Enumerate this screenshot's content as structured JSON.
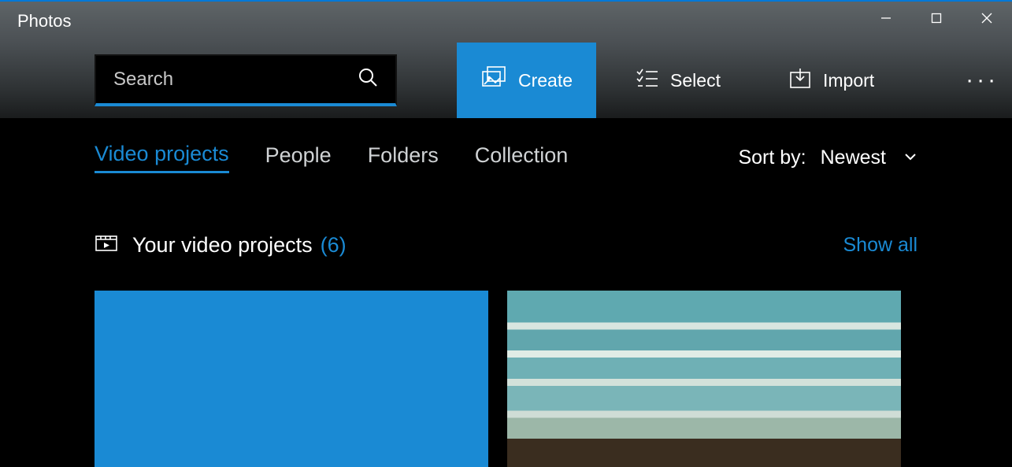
{
  "app": {
    "title": "Photos"
  },
  "search": {
    "placeholder": "Search"
  },
  "toolbar": {
    "create_label": "Create",
    "select_label": "Select",
    "import_label": "Import"
  },
  "tabs": {
    "video_projects": "Video projects",
    "people": "People",
    "folders": "Folders",
    "collection": "Collection"
  },
  "sort": {
    "label": "Sort by:",
    "value": "Newest"
  },
  "section": {
    "title": "Your video projects",
    "count": "(6)",
    "show_all": "Show all"
  }
}
